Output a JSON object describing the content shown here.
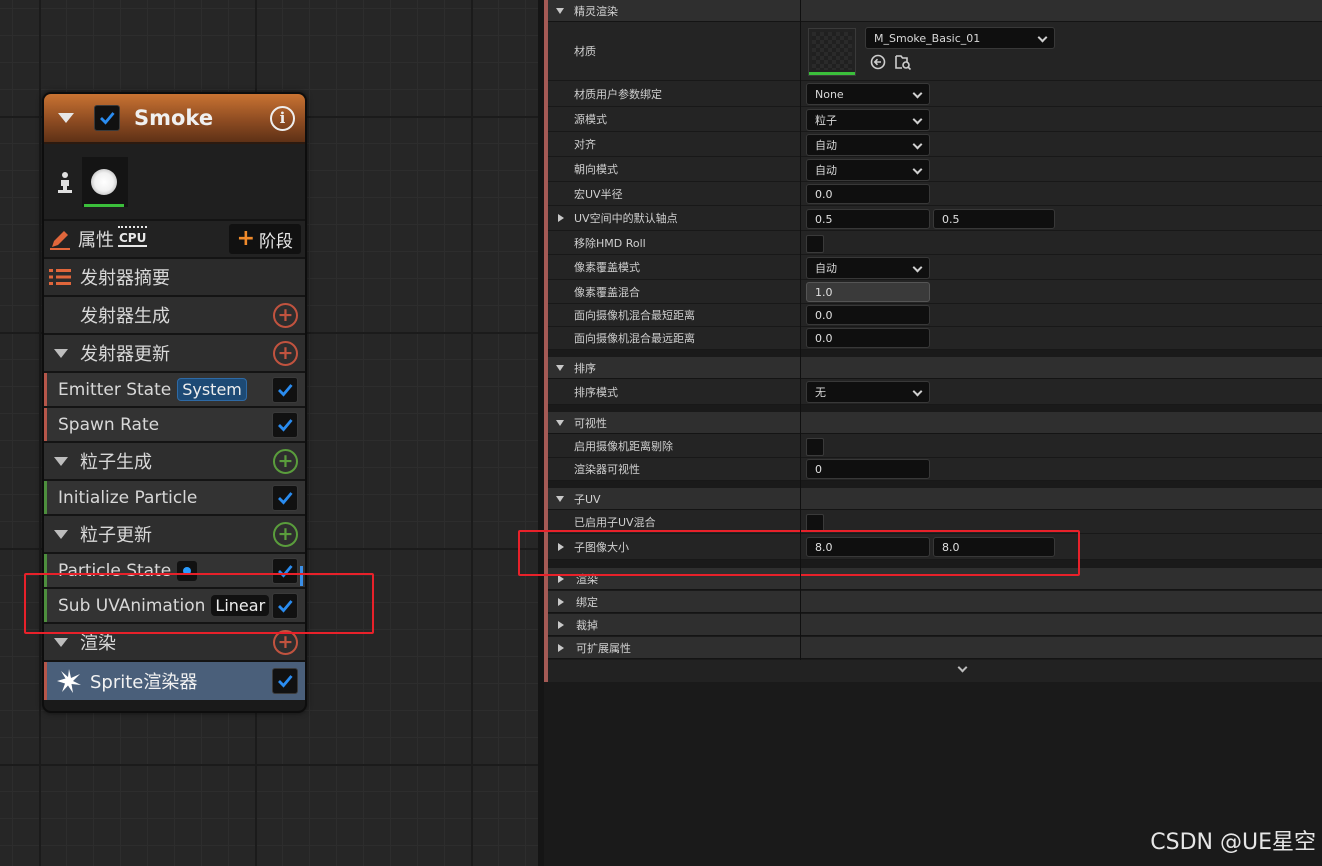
{
  "node": {
    "title": "Smoke",
    "properties_label": "属性",
    "cpu_label": "CPU",
    "stage_label": "阶段",
    "summary_label": "发射器摘要",
    "groups": {
      "emitter_spawn": "发射器生成",
      "emitter_update": "发射器更新",
      "particle_spawn": "粒子生成",
      "particle_update": "粒子更新",
      "render": "渲染"
    },
    "modules": {
      "emitter_state": {
        "label": "Emitter State",
        "tag": "System"
      },
      "spawn_rate": {
        "label": "Spawn Rate"
      },
      "initialize_particle": {
        "label": "Initialize Particle"
      },
      "particle_state": {
        "label": "Particle State"
      },
      "sub_uv": {
        "label": "Sub UVAnimation",
        "tag": "Linear"
      },
      "sprite_renderer": {
        "label": "Sprite渲染器"
      }
    }
  },
  "details": {
    "sections": {
      "sprite_render": "精灵渲染",
      "sorting": "排序",
      "visibility": "可视性",
      "sub_uv": "子UV",
      "render": "渲染",
      "bindings": "绑定",
      "culling": "裁掉",
      "extensible": "可扩展属性"
    },
    "rows": {
      "material": {
        "label": "材质",
        "value": "M_Smoke_Basic_01"
      },
      "material_user_param": {
        "label": "材质用户参数绑定",
        "value": "None"
      },
      "source_mode": {
        "label": "源模式",
        "value": "粒子"
      },
      "alignment": {
        "label": "对齐",
        "value": "自动"
      },
      "facing_mode": {
        "label": "朝向模式",
        "value": "自动"
      },
      "macro_uv_radius": {
        "label": "宏UV半径",
        "value": "0.0"
      },
      "pivot_uv": {
        "label": "UV空间中的默认轴点",
        "x": "0.5",
        "y": "0.5"
      },
      "remove_hmd_roll": {
        "label": "移除HMD Roll"
      },
      "pixel_coverage_mode": {
        "label": "像素覆盖模式",
        "value": "自动"
      },
      "pixel_coverage_blend": {
        "label": "像素覆盖混合",
        "value": "1.0"
      },
      "camera_blend_min": {
        "label": "面向摄像机混合最短距离",
        "value": "0.0"
      },
      "camera_blend_max": {
        "label": "面向摄像机混合最远距离",
        "value": "0.0"
      },
      "sort_mode": {
        "label": "排序模式",
        "value": "无"
      },
      "camera_distance_cull": {
        "label": "启用摄像机距离剔除"
      },
      "renderer_visibility": {
        "label": "渲染器可视性",
        "value": "0"
      },
      "sub_uv_blending": {
        "label": "已启用子UV混合"
      },
      "sub_image_size": {
        "label": "子图像大小",
        "x": "8.0",
        "y": "8.0"
      }
    }
  },
  "watermark": "CSDN @UE星空",
  "colors": {
    "accent_blue": "#2a8cf0",
    "highlight_red": "#e8212a",
    "header_orange": "#c97332"
  }
}
